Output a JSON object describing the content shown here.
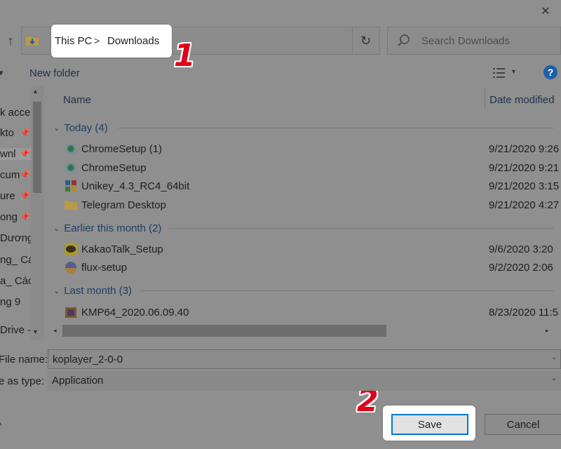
{
  "window": {
    "close_glyph": "✕"
  },
  "navigation": {
    "up_arrow_glyph": "↑",
    "breadcrumb": [
      "This PC",
      "Downloads"
    ],
    "breadcrumb_separator": ">",
    "refresh_glyph": "↻",
    "search_placeholder": "Search Downloads"
  },
  "callouts": {
    "first": "1",
    "second": "2"
  },
  "toolbar": {
    "organize_glyph": "▾",
    "new_folder_label": "New folder",
    "view_dropdown_glyph": "▾",
    "help_label": "?"
  },
  "left_pane": {
    "items": [
      "k acces",
      "kto",
      "wnl",
      "cum",
      "ure",
      "ong",
      "Dương",
      "ng_ Cá",
      "a_ Các",
      "ng 9",
      "Drive -"
    ],
    "pin_glyph": "📌",
    "scroll_up_glyph": "▲",
    "scroll_down_glyph": "▼"
  },
  "file_list": {
    "columns": {
      "name": "Name",
      "date": "Date modified"
    },
    "chevron_glyph": "⌄",
    "groups": [
      {
        "label": "Today (4)"
      },
      {
        "label": "Earlier this month (2)"
      },
      {
        "label": "Last month (3)"
      }
    ],
    "files": [
      {
        "name": "ChromeSetup (1)",
        "date": "9/21/2020 9:26",
        "icon": "chrome-setup-icon"
      },
      {
        "name": "ChromeSetup",
        "date": "9/21/2020 9:21",
        "icon": "chrome-setup-icon"
      },
      {
        "name": "Unikey_4.3_RC4_64bit",
        "date": "9/21/2020 3:15",
        "icon": "unikey-icon"
      },
      {
        "name": "Telegram Desktop",
        "date": "9/21/2020 4:27",
        "icon": "folder-icon"
      },
      {
        "name": "KakaoTalk_Setup",
        "date": "9/6/2020 3:20",
        "icon": "kakaotalk-icon"
      },
      {
        "name": "flux-setup",
        "date": "9/2/2020 2:06",
        "icon": "flux-icon"
      },
      {
        "name": "KMP64_2020.06.09.40",
        "date": "8/23/2020 11:5",
        "icon": "kmplayer-icon"
      }
    ],
    "scroll_left_glyph": "◂",
    "scroll_right_glyph": "▸"
  },
  "form": {
    "file_name_label": "File name:",
    "file_name_value": "koplayer_2-0-0",
    "save_type_label": "e as type:",
    "save_type_value": "Application",
    "dropdown_glyph": "⌄"
  },
  "buttons": {
    "save": "Save",
    "cancel": "Cancel"
  },
  "footer": {
    "hide_folders_glyph": "^"
  },
  "colors": {
    "accent": "#0078d7",
    "callout": "#e0001a",
    "dim_background": "#8f8f8f"
  }
}
